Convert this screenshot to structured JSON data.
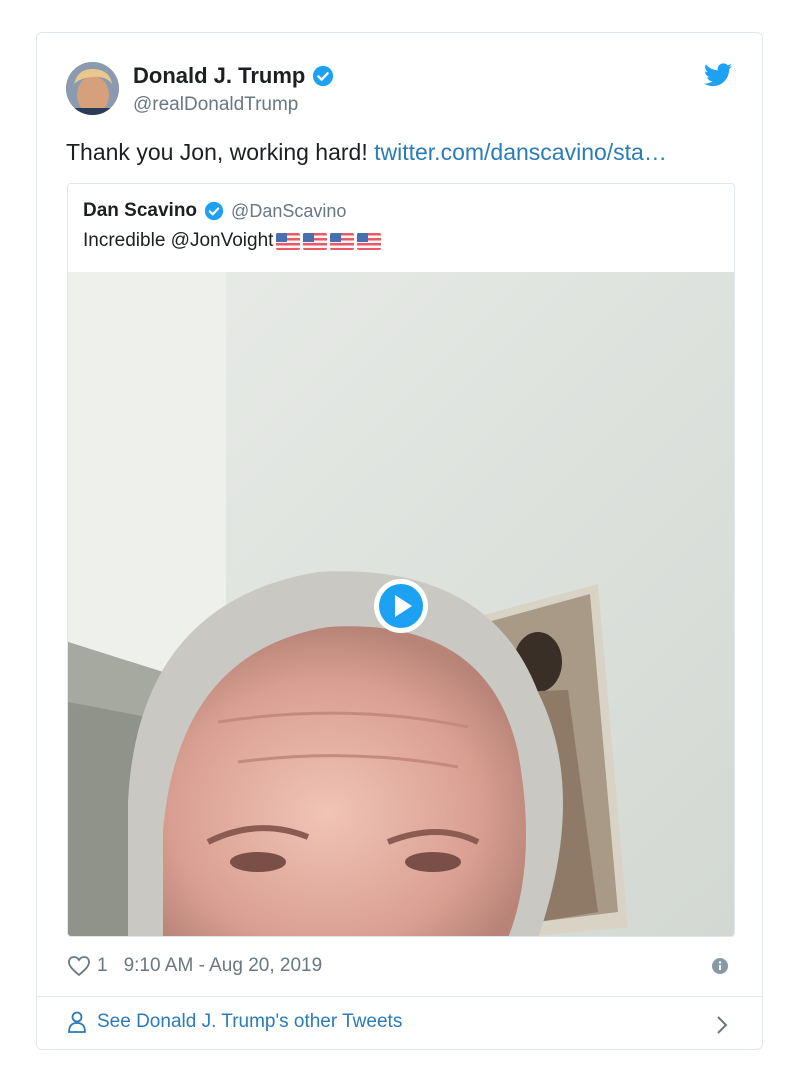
{
  "tweet": {
    "author_name": "Donald J. Trump",
    "author_handle": "@realDonaldTrump",
    "text": "Thank you Jon, working hard!",
    "link_text": "twitter.com/danscavino/sta…",
    "likes": "1",
    "timestamp": "9:10 AM - Aug 20, 2019"
  },
  "quoted": {
    "author_name": "Dan Scavino",
    "author_handle": "@DanScavino",
    "text": "Incredible @JonVoight",
    "flags": [
      "us-flag",
      "us-flag",
      "us-flag",
      "us-flag"
    ]
  },
  "footer": {
    "see_more": "See Donald J. Trump's other Tweets"
  },
  "icons": [
    "verified-badge-icon",
    "twitter-bird-icon",
    "play-icon",
    "heart-icon",
    "info-icon",
    "person-icon",
    "chevron-right-icon"
  ],
  "colors": {
    "brand_blue": "#1da1f2",
    "link": "#2b7bb9",
    "muted": "#697882",
    "border": "#e1e8ed"
  }
}
